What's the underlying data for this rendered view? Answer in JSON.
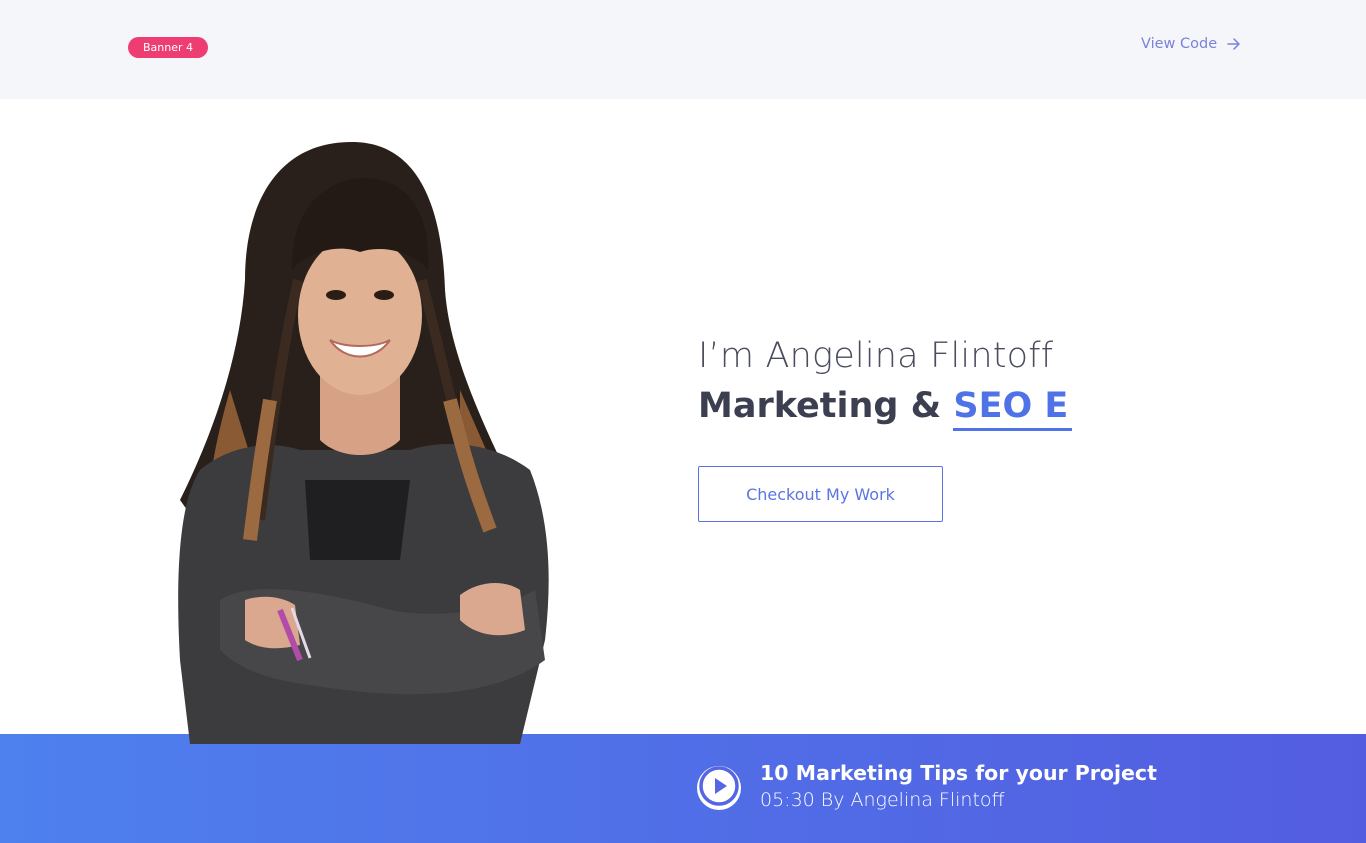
{
  "topbar": {
    "badge_label": "Banner 4",
    "view_code_label": "View Code",
    "view_code_icon": "arrow-right-icon"
  },
  "hero": {
    "intro": "I’m Angelina Flintoff",
    "headline_prefix": "Marketing & ",
    "headline_typed": "SEO E",
    "cta_label": "Checkout My Work",
    "portrait_icon": "person-portrait"
  },
  "video": {
    "play_icon": "play-icon",
    "title": "10 Marketing Tips for your Project",
    "meta": "05:30 By Angelina Flintoff"
  },
  "colors": {
    "badge": "#ee3d72",
    "accent": "#4f73e6",
    "band_start": "#4e80ee",
    "band_end": "#535de0",
    "topbar_bg": "#f4f6fa"
  }
}
